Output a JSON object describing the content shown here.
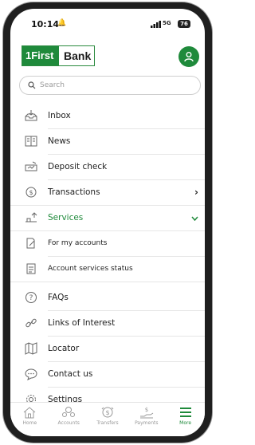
{
  "status_bar": {
    "time": "10:14",
    "network": "5G",
    "battery": "76"
  },
  "brand": {
    "logo_part1": "1First",
    "logo_part2": "Bank"
  },
  "search": {
    "placeholder": "Search"
  },
  "menu": {
    "inbox": "Inbox",
    "news": "News",
    "deposit_check": "Deposit check",
    "transactions": "Transactions",
    "services": "Services",
    "for_my_accounts": "For my accounts",
    "account_services_status": "Account services status",
    "faqs": "FAQs",
    "links_of_interest": "Links of Interest",
    "locator": "Locator",
    "contact_us": "Contact us",
    "settings": "Settings"
  },
  "tabs": {
    "home": "Home",
    "accounts": "Accounts",
    "transfers": "Transfers",
    "payments": "Payments",
    "more": "More"
  },
  "colors": {
    "accent": "#1f8a3b",
    "text": "#222222"
  }
}
